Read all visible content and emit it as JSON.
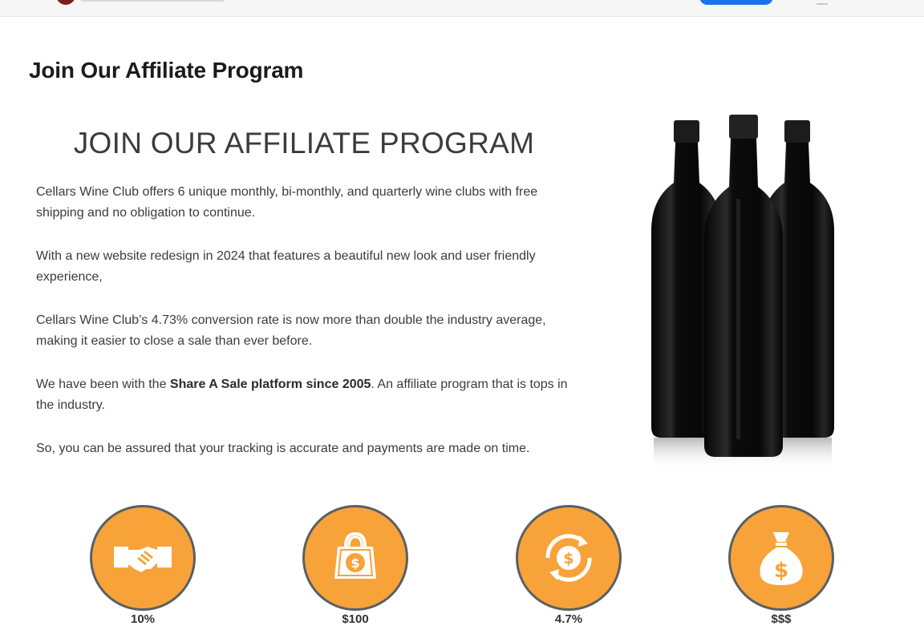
{
  "header": {
    "logo_icon": "wine-logo-icon",
    "button_color": "#1a73e8"
  },
  "page_title": "Join Our Affiliate Program",
  "main": {
    "heading": "JOIN OUR AFFILIATE PROGRAM",
    "paragraphs": [
      {
        "text": "Cellars Wine Club offers 6 unique monthly, bi-monthly, and quarterly wine clubs with free shipping and no obligation to continue."
      },
      {
        "text": "With a new website redesign in 2024 that features a beautiful new look and user friendly experience,"
      },
      {
        "text": "Cellars Wine Club’s 4.73% conversion rate is now more than double the industry average, making it easier to close a sale than ever before."
      },
      {
        "before": "We have been with the ",
        "bold": "Share A Sale platform since 2005",
        "after": ". An affiliate program that is tops in the industry."
      },
      {
        "text": "So, you can be assured that your tracking is accurate and payments are made on time."
      }
    ]
  },
  "image": {
    "name": "three-wine-bottles-image"
  },
  "features": [
    {
      "icon": "handshake-icon",
      "label": "10%"
    },
    {
      "icon": "shopping-bag-dollar-icon",
      "label": "$100"
    },
    {
      "icon": "circular-dollar-arrows-icon",
      "label": "4.7%"
    },
    {
      "icon": "money-bag-icon",
      "label": "$$$"
    }
  ],
  "colors": {
    "accent_orange": "#f7a33a",
    "circle_border": "#5a5f63",
    "bottle_glass": "#111111"
  }
}
